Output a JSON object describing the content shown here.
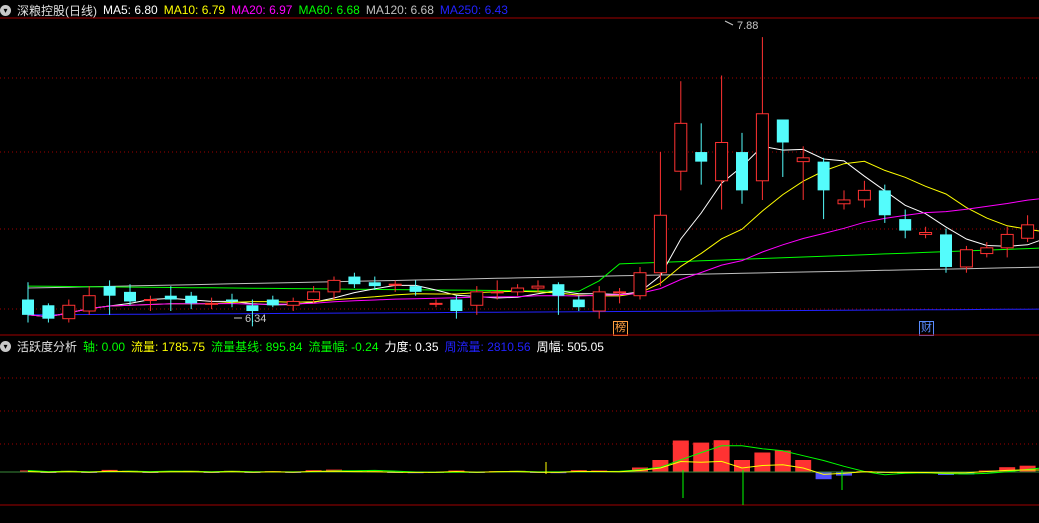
{
  "main_panel": {
    "title": "深粮控股(日线)",
    "indicators": [
      {
        "label": "MA5: 6.80",
        "color": "#ffffff"
      },
      {
        "label": "MA10: 6.79",
        "color": "#ffff00"
      },
      {
        "label": "MA20: 6.97",
        "color": "#ff00ff"
      },
      {
        "label": "MA60: 6.68",
        "color": "#00ff00"
      },
      {
        "label": "MA120: 6.68",
        "color": "#c0c0c0"
      },
      {
        "label": "MA250: 6.43",
        "color": "#2222ff"
      }
    ],
    "high_label": "7.88",
    "low_label": "6.34",
    "markers": [
      {
        "text": "榜",
        "color": "#ffa040"
      },
      {
        "text": "财",
        "color": "#5a8cff"
      }
    ]
  },
  "sub_panel": {
    "title": "活跃度分析",
    "indicators": [
      {
        "label": "轴: 0.00",
        "color": "#00ff00"
      },
      {
        "label": "流量: 1785.75",
        "color": "#ffff00"
      },
      {
        "label": "流量基线: 895.84",
        "color": "#00ff00"
      },
      {
        "label": "流量幅: -0.24",
        "color": "#00ff00"
      },
      {
        "label": "力度: 0.35",
        "color": "#ffffff"
      },
      {
        "label": "周流量: 2810.56",
        "color": "#2222ff"
      },
      {
        "label": "周幅: 505.05",
        "color": "#ffffff"
      }
    ]
  },
  "bottom_panel": {
    "label": "..."
  },
  "colors": {
    "up": "#ff3232",
    "down": "#54fcfc",
    "grid": "#a00000",
    "border": "#a00000"
  },
  "chart_data": {
    "type": "candlestick",
    "ohlc": [
      [
        6.48,
        6.4,
        6.57,
        6.36
      ],
      [
        6.45,
        6.38,
        6.46,
        6.36
      ],
      [
        6.38,
        6.45,
        6.48,
        6.36
      ],
      [
        6.42,
        6.5,
        6.55,
        6.4
      ],
      [
        6.55,
        6.5,
        6.58,
        6.4
      ],
      [
        6.52,
        6.47,
        6.56,
        6.45
      ],
      [
        6.48,
        6.48,
        6.5,
        6.42
      ],
      [
        6.5,
        6.48,
        6.55,
        6.42
      ],
      [
        6.5,
        6.46,
        6.52,
        6.43
      ],
      [
        6.46,
        6.46,
        6.49,
        6.43
      ],
      [
        6.48,
        6.47,
        6.51,
        6.44
      ],
      [
        6.45,
        6.42,
        6.48,
        6.34
      ],
      [
        6.48,
        6.45,
        6.5,
        6.44
      ],
      [
        6.45,
        6.47,
        6.49,
        6.42
      ],
      [
        6.48,
        6.52,
        6.55,
        6.46
      ],
      [
        6.52,
        6.58,
        6.6,
        6.48
      ],
      [
        6.6,
        6.56,
        6.62,
        6.54
      ],
      [
        6.57,
        6.55,
        6.6,
        6.53
      ],
      [
        6.56,
        6.56,
        6.58,
        6.52
      ],
      [
        6.55,
        6.52,
        6.58,
        6.5
      ],
      [
        6.46,
        6.46,
        6.48,
        6.44
      ],
      [
        6.48,
        6.42,
        6.5,
        6.38
      ],
      [
        6.45,
        6.52,
        6.55,
        6.4
      ],
      [
        6.52,
        6.52,
        6.58,
        6.48
      ],
      [
        6.52,
        6.54,
        6.56,
        6.5
      ],
      [
        6.54,
        6.55,
        6.58,
        6.52
      ],
      [
        6.56,
        6.5,
        6.57,
        6.4
      ],
      [
        6.48,
        6.44,
        6.5,
        6.42
      ],
      [
        6.42,
        6.52,
        6.55,
        6.38
      ],
      [
        6.52,
        6.52,
        6.54,
        6.46
      ],
      [
        6.5,
        6.62,
        6.65,
        6.48
      ],
      [
        6.62,
        6.92,
        7.25,
        6.55
      ],
      [
        7.15,
        7.4,
        7.62,
        7.05
      ],
      [
        7.25,
        7.2,
        7.4,
        7.08
      ],
      [
        7.1,
        7.3,
        7.65,
        6.95
      ],
      [
        7.25,
        7.05,
        7.35,
        6.98
      ],
      [
        7.1,
        7.45,
        7.85,
        7.0
      ],
      [
        7.42,
        7.3,
        7.42,
        7.12
      ],
      [
        7.2,
        7.22,
        7.28,
        7.0
      ],
      [
        7.2,
        7.05,
        7.22,
        6.9
      ],
      [
        6.98,
        7.0,
        7.05,
        6.95
      ],
      [
        7.0,
        7.05,
        7.1,
        6.96
      ],
      [
        7.05,
        6.92,
        7.08,
        6.88
      ],
      [
        6.9,
        6.84,
        6.95,
        6.8
      ],
      [
        6.82,
        6.83,
        6.86,
        6.8
      ],
      [
        6.82,
        6.65,
        6.85,
        6.62
      ],
      [
        6.65,
        6.74,
        6.76,
        6.62
      ],
      [
        6.72,
        6.75,
        6.78,
        6.7
      ],
      [
        6.75,
        6.82,
        6.86,
        6.7
      ],
      [
        6.8,
        6.87,
        6.92,
        6.78
      ],
      [
        6.85,
        6.84,
        6.88,
        6.8
      ]
    ],
    "volume": [
      5,
      -2,
      4,
      -3,
      7,
      4,
      -2,
      3,
      4,
      -2,
      4,
      -3,
      3,
      -2,
      6,
      8,
      4,
      3,
      -3,
      -4,
      -2,
      5,
      -3,
      3,
      4,
      -2,
      -4,
      6,
      5,
      3,
      15,
      40,
      105,
      98,
      106,
      40,
      65,
      72,
      40,
      -24,
      -12,
      3,
      -3,
      -4,
      -5,
      -10,
      -8,
      5,
      16,
      21,
      19
    ]
  }
}
